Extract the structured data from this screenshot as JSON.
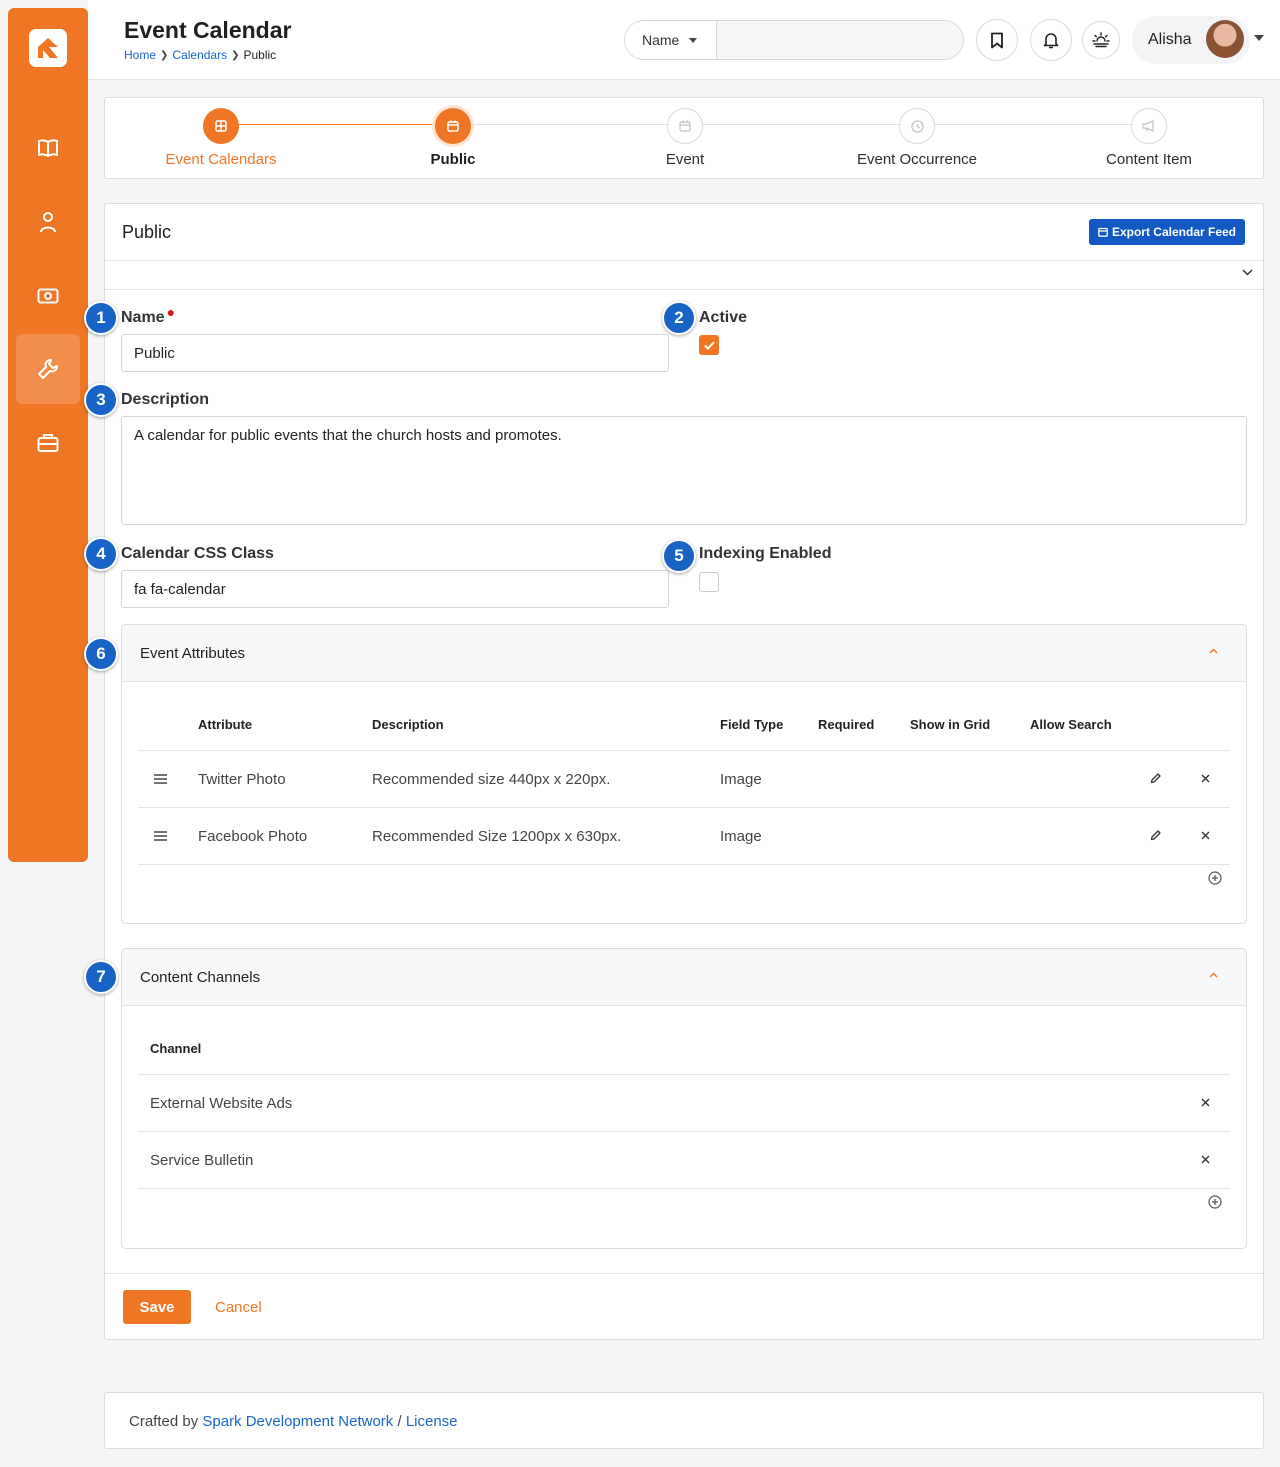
{
  "header": {
    "title": "Event Calendar",
    "breadcrumb": [
      "Home",
      "Calendars",
      "Public"
    ],
    "search_type": "Name",
    "search_placeholder": "",
    "user_name": "Alisha"
  },
  "wizard": {
    "steps": [
      {
        "label": "Event Calendars",
        "state": "done",
        "icon": "grid-icon"
      },
      {
        "label": "Public",
        "state": "current",
        "icon": "calendar-icon"
      },
      {
        "label": "Event",
        "state": "todo",
        "icon": "calendar-icon"
      },
      {
        "label": "Event Occurrence",
        "state": "todo",
        "icon": "clock-icon"
      },
      {
        "label": "Content Item",
        "state": "todo",
        "icon": "bullhorn-icon"
      }
    ]
  },
  "panel": {
    "title": "Public",
    "export_button": "Export Calendar Feed"
  },
  "markers": [
    "1",
    "2",
    "3",
    "4",
    "5",
    "6",
    "7"
  ],
  "form": {
    "name_label": "Name",
    "name_value": "Public",
    "active_label": "Active",
    "active_checked": true,
    "description_label": "Description",
    "description_value": "A calendar for public events that the church hosts and promotes.",
    "css_label": "Calendar CSS Class",
    "css_value": "fa fa-calendar",
    "indexing_label": "Indexing Enabled",
    "indexing_checked": false
  },
  "event_attributes": {
    "title": "Event Attributes",
    "columns": [
      "Attribute",
      "Description",
      "Field Type",
      "Required",
      "Show in Grid",
      "Allow Search"
    ],
    "rows": [
      {
        "attribute": "Twitter Photo",
        "description": "Recommended size 440px x 220px.",
        "field_type": "Image"
      },
      {
        "attribute": "Facebook Photo",
        "description": "Recommended Size 1200px x 630px.",
        "field_type": "Image"
      }
    ]
  },
  "content_channels": {
    "title": "Content Channels",
    "column": "Channel",
    "rows": [
      "External Website Ads",
      "Service Bulletin"
    ]
  },
  "actions": {
    "save": "Save",
    "cancel": "Cancel"
  },
  "footer": {
    "prefix": "Crafted by",
    "link1": "Spark Development Network",
    "sep": "/",
    "link2": "License"
  },
  "colors": {
    "brand": "#ee7624",
    "link": "#1b66c9",
    "marker": "#1863c6",
    "button_primary": "#1359c4"
  }
}
